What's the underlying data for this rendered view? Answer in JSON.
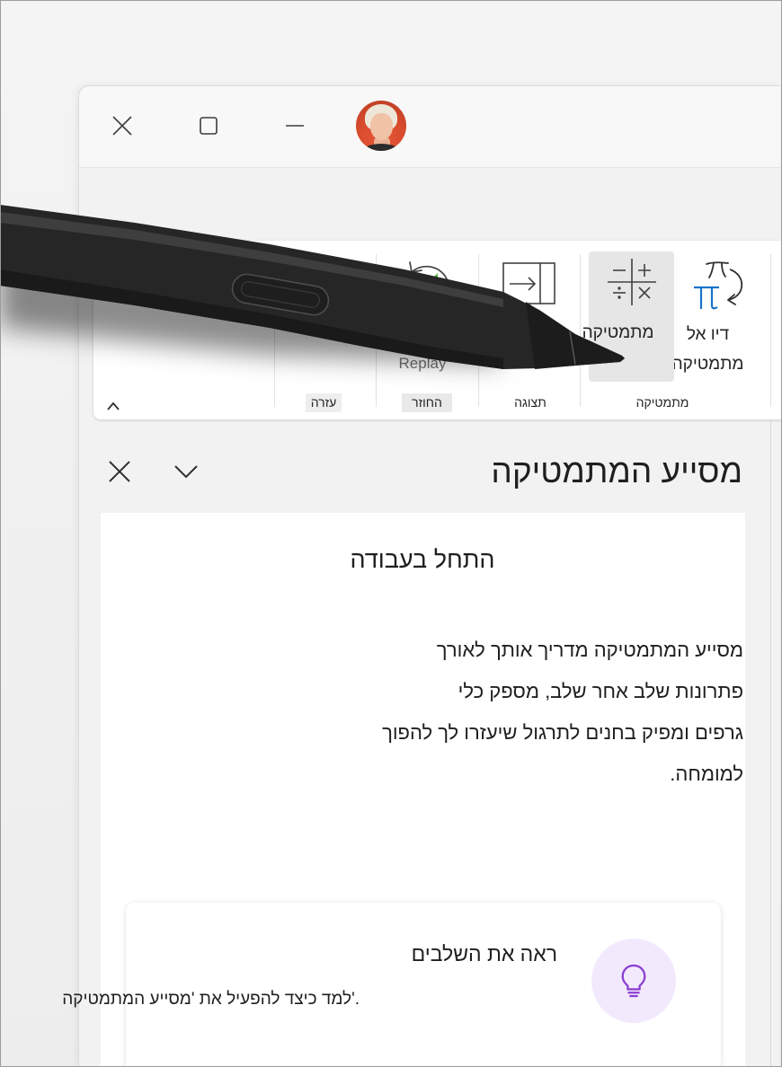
{
  "window": {
    "controls": {
      "close_icon": "close-icon",
      "maximize_icon": "maximize-icon",
      "minimize_icon": "minimize-icon"
    },
    "avatar_icon": "user-avatar-icon"
  },
  "ribbon": {
    "collapse_icon": "chevron-up-icon",
    "math_group": {
      "label": "מתמטיקה",
      "ink_to_math": {
        "label_lines": [
          "דיו אל",
          "מתמטיקה"
        ],
        "icon": "ink-to-math-icon"
      },
      "math": {
        "label": "מתמטיקה",
        "icon": "math-operators-icon"
      }
    },
    "view_group": {
      "label": "תצוגה",
      "icon": "view-panel-icon"
    },
    "replay_group": {
      "label": "החוזר",
      "replay": {
        "label": "Replay",
        "icon": "replay-icon"
      }
    },
    "help_group": {
      "label": "עזרה",
      "icon": "help-icon"
    }
  },
  "pane": {
    "title": "מסייע המתמטיקה",
    "collapse_icon": "chevron-down-icon",
    "close_icon": "close-icon",
    "heading": "התחל בעבודה",
    "intro_lines": [
      "מסייע המתמטיקה מדריך אותך לאורך",
      "פתרונות שלב אחר שלב, מספק כלי",
      "גרפים ומפיק בחנים לתרגול שיעזרו לך להפוך",
      "למומחה."
    ],
    "tip": {
      "icon": "lightbulb-icon",
      "title": "ראה את השלבים",
      "text": "למד כיצד להפעיל את 'מסייע המתמטיקה'."
    }
  },
  "overlay": {
    "stylus_icon": "stylus-pen-icon"
  },
  "colors": {
    "accent_purple": "#8a3fd1",
    "lightbulb_bg": "#f3e9fd",
    "replay_green": "#5fb342",
    "ink_blue": "#1a73c8",
    "math_button_highlight": "#e6e6e6"
  }
}
